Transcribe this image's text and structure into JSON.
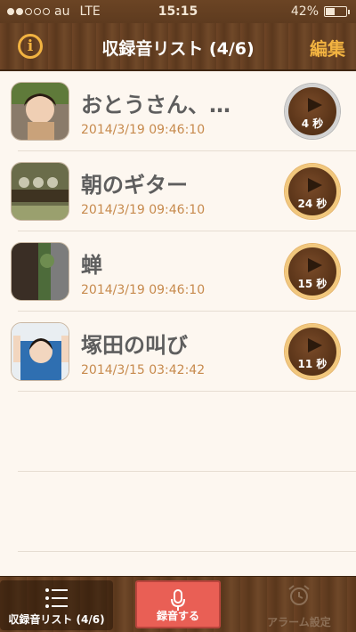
{
  "status": {
    "carrier": "au",
    "network": "LTE",
    "time": "15:15",
    "battery": "42%",
    "battery_level": 0.42
  },
  "nav": {
    "info": "i",
    "title": "収録音リスト (4/6)",
    "edit": "編集"
  },
  "items": [
    {
      "title": "おとうさん、…",
      "date": "2014/3/19 09:46:10",
      "duration": "4 秒"
    },
    {
      "title": "朝のギター",
      "date": "2014/3/19 09:46:10",
      "duration": "24 秒"
    },
    {
      "title": "蝉",
      "date": "2014/3/19 09:46:10",
      "duration": "15 秒"
    },
    {
      "title": "塚田の叫び",
      "date": "2014/3/15 03:42:42",
      "duration": "11 秒"
    }
  ],
  "tabs": {
    "list": "収録音リスト (4/6)",
    "record": "録音する",
    "alarm": "アラーム設定"
  },
  "colors": {
    "accent": "#f2b341",
    "date": "#c78a4d",
    "record": "#e95f55"
  }
}
